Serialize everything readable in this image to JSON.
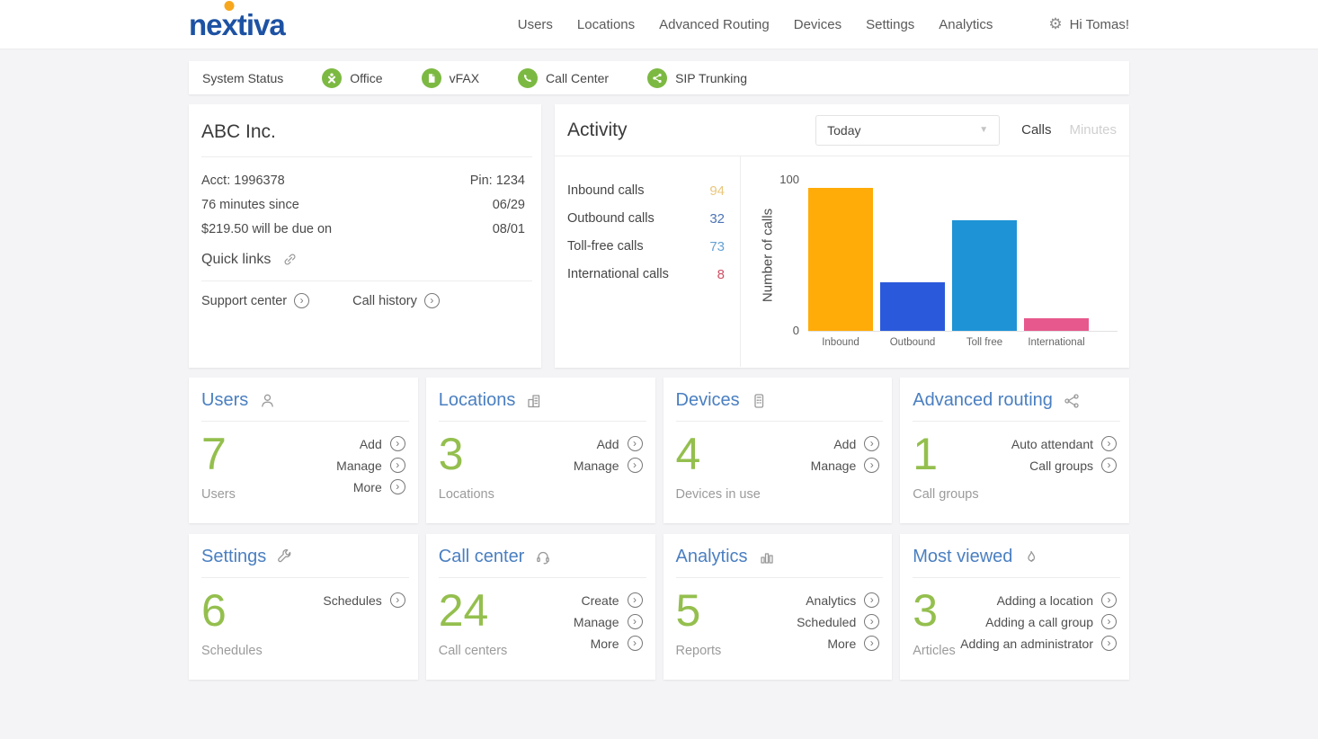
{
  "brand": {
    "part1": "ne",
    "part2": "x",
    "part3": "tiva"
  },
  "nav": {
    "items": [
      "Users",
      "Locations",
      "Advanced Routing",
      "Devices",
      "Settings",
      "Analytics"
    ],
    "greeting": "Hi Tomas!"
  },
  "status_bar": {
    "label": "System Status",
    "items": [
      {
        "name": "Office"
      },
      {
        "name": "vFAX"
      },
      {
        "name": "Call Center"
      },
      {
        "name": "SIP Trunking"
      }
    ],
    "icon_color": "#7cb942"
  },
  "account": {
    "company": "ABC Inc.",
    "rows": [
      {
        "left": "Acct: 1996378",
        "right": "Pin: 1234"
      },
      {
        "left": "76 minutes since",
        "right": "06/29"
      },
      {
        "left": "$219.50 will be due on",
        "right": "08/01"
      }
    ],
    "quick_links_label": "Quick links",
    "links": [
      {
        "label": "Support center"
      },
      {
        "label": "Call history"
      }
    ]
  },
  "activity": {
    "title": "Activity",
    "period_selected": "Today",
    "toggle": {
      "calls": "Calls",
      "minutes": "Minutes",
      "active": "Calls"
    },
    "stats": [
      {
        "label": "Inbound calls",
        "value": 94,
        "color": "#e9c77c"
      },
      {
        "label": "Outbound calls",
        "value": 32,
        "color": "#4d74b5"
      },
      {
        "label": "Toll-free calls",
        "value": 73,
        "color": "#64a2d3"
      },
      {
        "label": "International calls",
        "value": 8,
        "color": "#cf5064"
      }
    ]
  },
  "chart_data": {
    "type": "bar",
    "categories": [
      "Inbound",
      "Outbound",
      "Toll free",
      "International"
    ],
    "values": [
      94,
      32,
      73,
      8
    ],
    "colors": [
      "#ffab08",
      "#2a5adb",
      "#1e93d6",
      "#e7588c"
    ],
    "title": "",
    "xlabel": "",
    "ylabel": "Number of calls",
    "ylim": [
      0,
      100
    ],
    "yticks": [
      0,
      100
    ],
    "grid": false,
    "legend": false
  },
  "cards": {
    "users": {
      "title": "Users",
      "count": "7",
      "count_label": "Users",
      "actions": [
        "Add",
        "Manage",
        "More"
      ]
    },
    "locations": {
      "title": "Locations",
      "count": "3",
      "count_label": "Locations",
      "actions": [
        "Add",
        "Manage"
      ]
    },
    "devices": {
      "title": "Devices",
      "count": "4",
      "count_label": "Devices in use",
      "actions": [
        "Add",
        "Manage"
      ]
    },
    "routing": {
      "title": "Advanced routing",
      "count": "1",
      "count_label": "Call groups",
      "actions": [
        "Auto attendant",
        "Call groups"
      ]
    },
    "settings": {
      "title": "Settings",
      "count": "6",
      "count_label": "Schedules",
      "actions": [
        "Schedules"
      ]
    },
    "call_center": {
      "title": "Call center",
      "count": "24",
      "count_label": "Call centers",
      "actions": [
        "Create",
        "Manage",
        "More"
      ]
    },
    "analytics": {
      "title": "Analytics",
      "count": "5",
      "count_label": "Reports",
      "actions": [
        "Analytics",
        "Scheduled",
        "More"
      ]
    },
    "most_viewed": {
      "title": "Most viewed",
      "count": "3",
      "count_label": "Articles",
      "actions": [
        "Adding a location",
        "Adding a call group",
        "Adding an administrator"
      ]
    }
  },
  "colors": {
    "brand_blue": "#1d52a3",
    "brand_orange": "#f7a71d",
    "card_title_blue": "#4a7fc1",
    "count_green": "#94bf4e",
    "status_green": "#7cb942"
  }
}
